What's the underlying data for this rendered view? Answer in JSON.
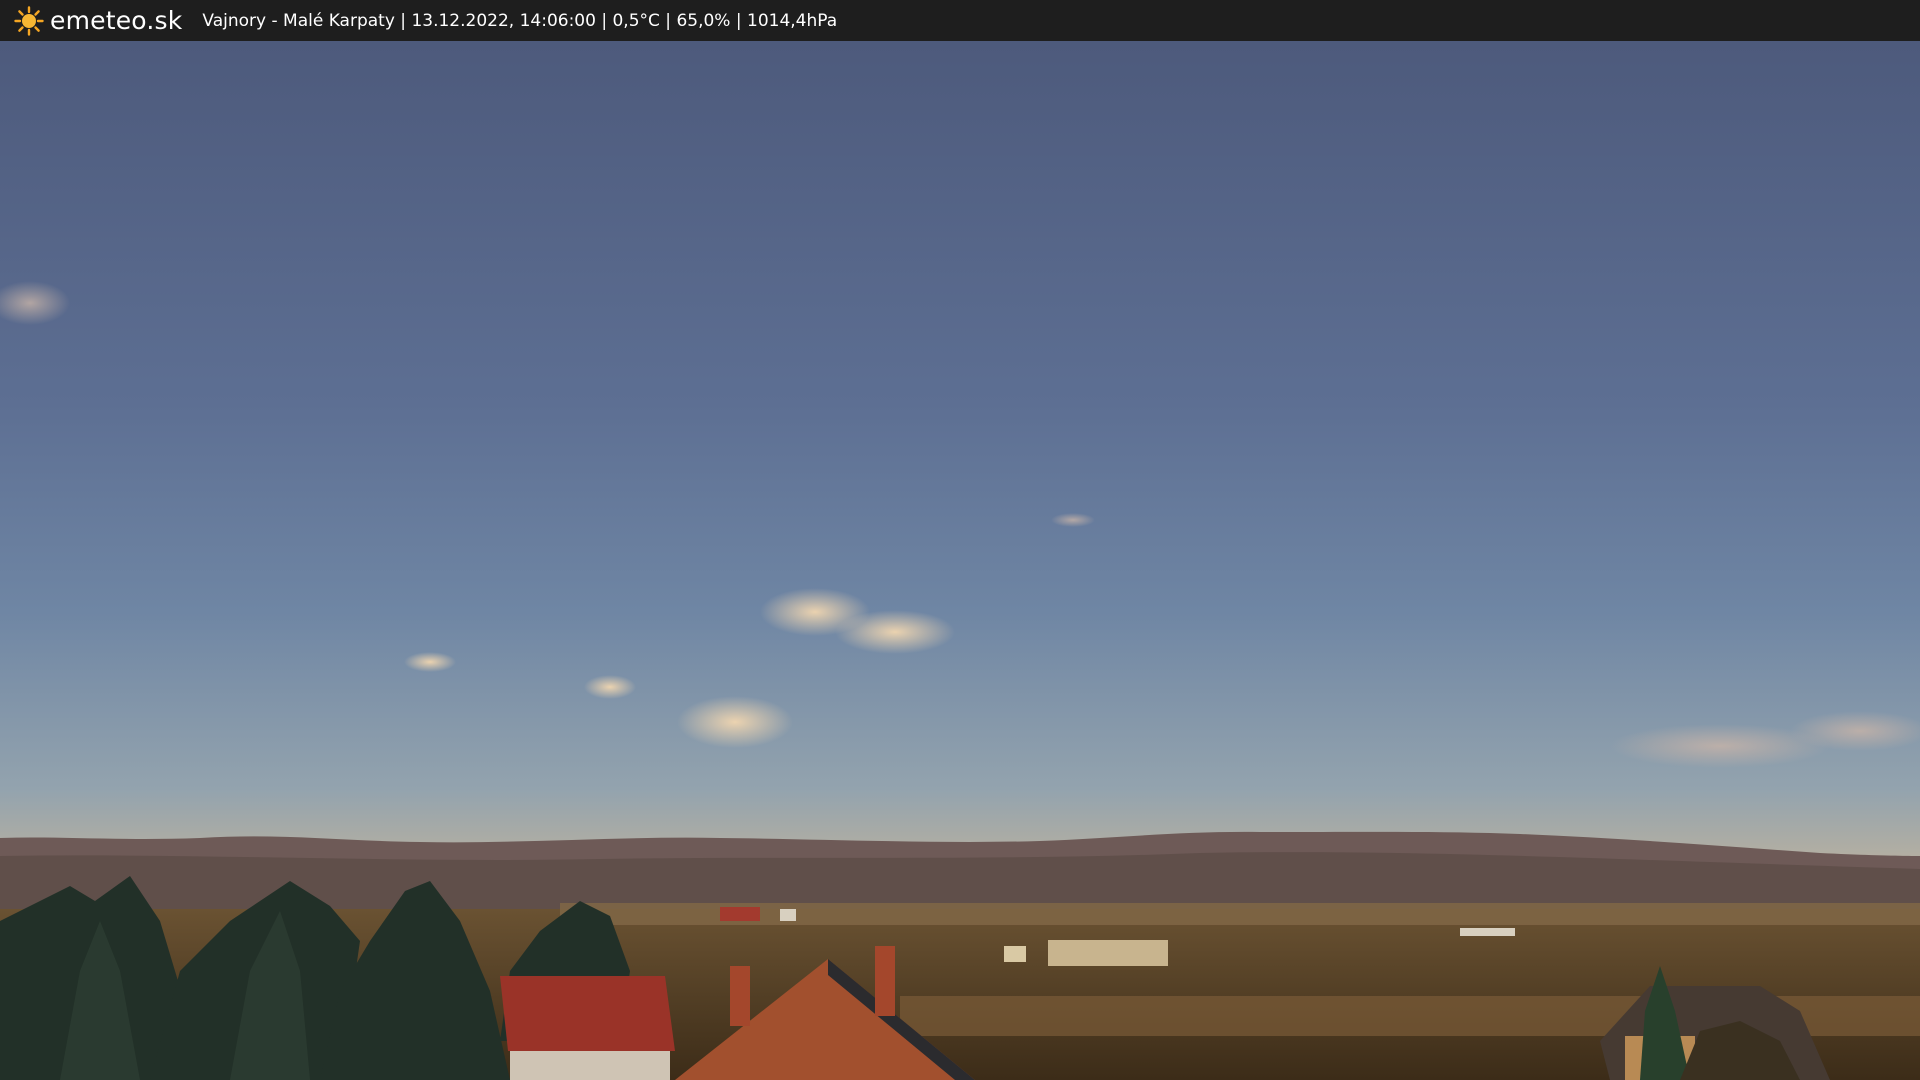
{
  "header": {
    "logo_icon": "sun-icon",
    "logo_text": "emeteo.sk",
    "location": "Vajnory - Malé Karpaty",
    "separator": "|",
    "datetime": "13.12.2022, 14:06:00",
    "temperature": "0,5°C",
    "humidity": "65,0%",
    "pressure": "1014,4hPa"
  },
  "colors": {
    "bar_background": "#1e1e1e",
    "bar_text": "#ffffff",
    "sun_accent": "#f5a623",
    "sky_top": "#4d5a7c",
    "sky_horizon": "#d8b98c"
  }
}
